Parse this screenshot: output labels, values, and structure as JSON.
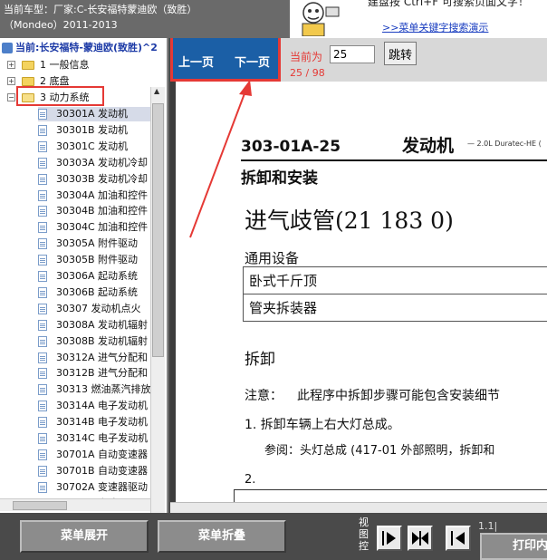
{
  "header": {
    "line1": "当前车型：厂家:C-长安福特蒙迪欧（致胜）",
    "line2": "（Mondeo）2011-2013"
  },
  "promo": {
    "text": "建盘按 Ctrl+F 可搜索页面文字！",
    "link": ">>菜单关键字搜索演示"
  },
  "tree": {
    "current": "当前:长安福特-蒙迪欧(致胜)^2",
    "folders": [
      {
        "label": "1 一般信息",
        "expander": "+"
      },
      {
        "label": "2 底盘",
        "expander": "+"
      },
      {
        "label": "3 动力系统",
        "expander": "−"
      }
    ],
    "items": [
      "30301A 发动机",
      "30301B 发动机",
      "30301C 发动机",
      "30303A 发动机冷却",
      "30303B 发动机冷却",
      "30304A 加油和控件",
      "30304B 加油和控件",
      "30304C 加油和控件",
      "30305A 附件驱动",
      "30305B 附件驱动",
      "30306A 起动系统",
      "30306B 起动系统",
      "30307 发动机点火",
      "30308A 发动机辐射",
      "30308B 发动机辐射",
      "30312A 进气分配和",
      "30312B 进气分配和",
      "30313 燃油蒸汽排放",
      "30314A 电子发动机",
      "30314B 电子发动机",
      "30314C 电子发动机",
      "30701A 自动变速器",
      "30701B 自动变速器",
      "30702A 变速器驱动",
      "30702B 变速器驱动"
    ]
  },
  "toolbar": {
    "prev_label": "上一页",
    "next_label": "下一页",
    "current_label": "当前为",
    "page_value": "25",
    "jump_label": "跳转",
    "page_count": "25 / 98"
  },
  "document": {
    "code": "303-01A-25",
    "section": "发动机",
    "engine": "— 2.0L Duratec-HE (",
    "heading": "拆卸和安装",
    "part_title": "进气歧管(21 183 0)",
    "equipment_label": "通用设备",
    "equipment": [
      "卧式千斤顶",
      "管夹拆装器"
    ],
    "remove_title": "拆卸",
    "note_label": "注意：",
    "note_text": "此程序中拆卸步骤可能包含安装细节",
    "step1": "1.  拆卸车辆上右大灯总成。",
    "step1_ref": "参阅：头灯总成 (417-01 外部照明，拆卸和",
    "step2": "2."
  },
  "bottom": {
    "expand_label": "菜单展开",
    "collapse_label": "菜单折叠",
    "view_label": "视图控",
    "zoom_readout": "1.1|",
    "print_label": "打印内"
  },
  "colors": {
    "accent_red": "#e53935",
    "nav_blue": "#1b5fa6",
    "link_blue": "#1a3ec0"
  }
}
